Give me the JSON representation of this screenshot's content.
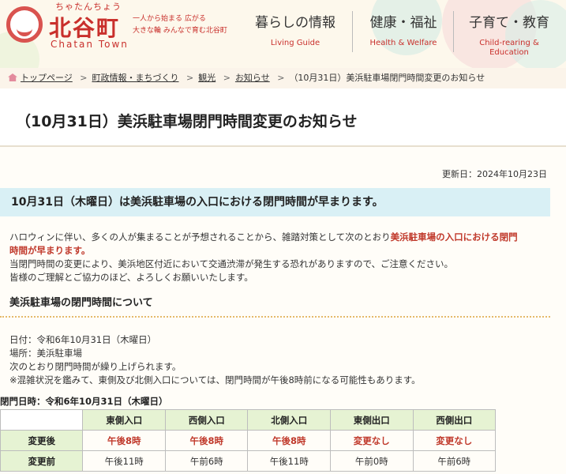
{
  "header": {
    "logo_ruby": "ちゃたんちょう",
    "logo_name": "北谷町",
    "logo_en": "Chatan Town",
    "slogan_1": "一人から始まる 広がる",
    "slogan_2": "大きな輪 みんなで育む北谷町",
    "nav": [
      {
        "jp": "暮らしの情報",
        "en": "Living Guide"
      },
      {
        "jp": "健康・福祉",
        "en": "Health & Welfare"
      },
      {
        "jp": "子育て・教育",
        "en": "Child-rearing &",
        "en2": "Education"
      }
    ],
    "brand_color": "#c9302c"
  },
  "breadcrumb": {
    "items": [
      "トップページ",
      "町政情報・まちづくり",
      "観光",
      "お知らせ"
    ],
    "current": "（10月31日）美浜駐車場閉門時間変更のお知らせ",
    "separator": ">"
  },
  "page": {
    "title": "（10月31日）美浜駐車場閉門時間変更のお知らせ",
    "updated": "更新日：2024年10月23日",
    "lead": "10月31日（木曜日）は美浜駐車場の入口における閉門時間が早まります。",
    "para1_a": "ハロウィンに伴い、多くの人が集まることが予想されることから、雑踏対策として次のとおり",
    "para1_b": "美浜駐車場の入口における閉門",
    "para1_c": "時間が早まります。",
    "para2": "当閉門時間の変更により、美浜地区付近において交通渋滞が発生する恐れがありますので、ご注意ください。",
    "para3": "皆様のご理解とご協力のほど、よろしくお願いいたします。",
    "subhead": "美浜駐車場の閉門時間について",
    "date_line": "日付：令和6年10月31日（木曜日）",
    "place_line": "場所：美浜駐車場",
    "note_line": "次のとおり閉門時間が繰り上げられます。",
    "warn_line": "※混雑状況を鑑みて、東側及び北側入口については、閉門時間が午後8時前になる可能性もあります。",
    "table_caption": "閉門日時：令和6年10月31日（木曜日）"
  },
  "table": {
    "headers": [
      "東側入口",
      "西側入口",
      "北側入口",
      "東側出口",
      "西側出口"
    ],
    "rows": [
      {
        "label": "変更後",
        "cells": [
          "午後8時",
          "午後8時",
          "午後8時",
          "変更なし",
          "変更なし"
        ]
      },
      {
        "label": "変更前",
        "cells": [
          "午後11時",
          "午前6時",
          "午後11時",
          "午前0時",
          "午前6時"
        ]
      }
    ]
  }
}
